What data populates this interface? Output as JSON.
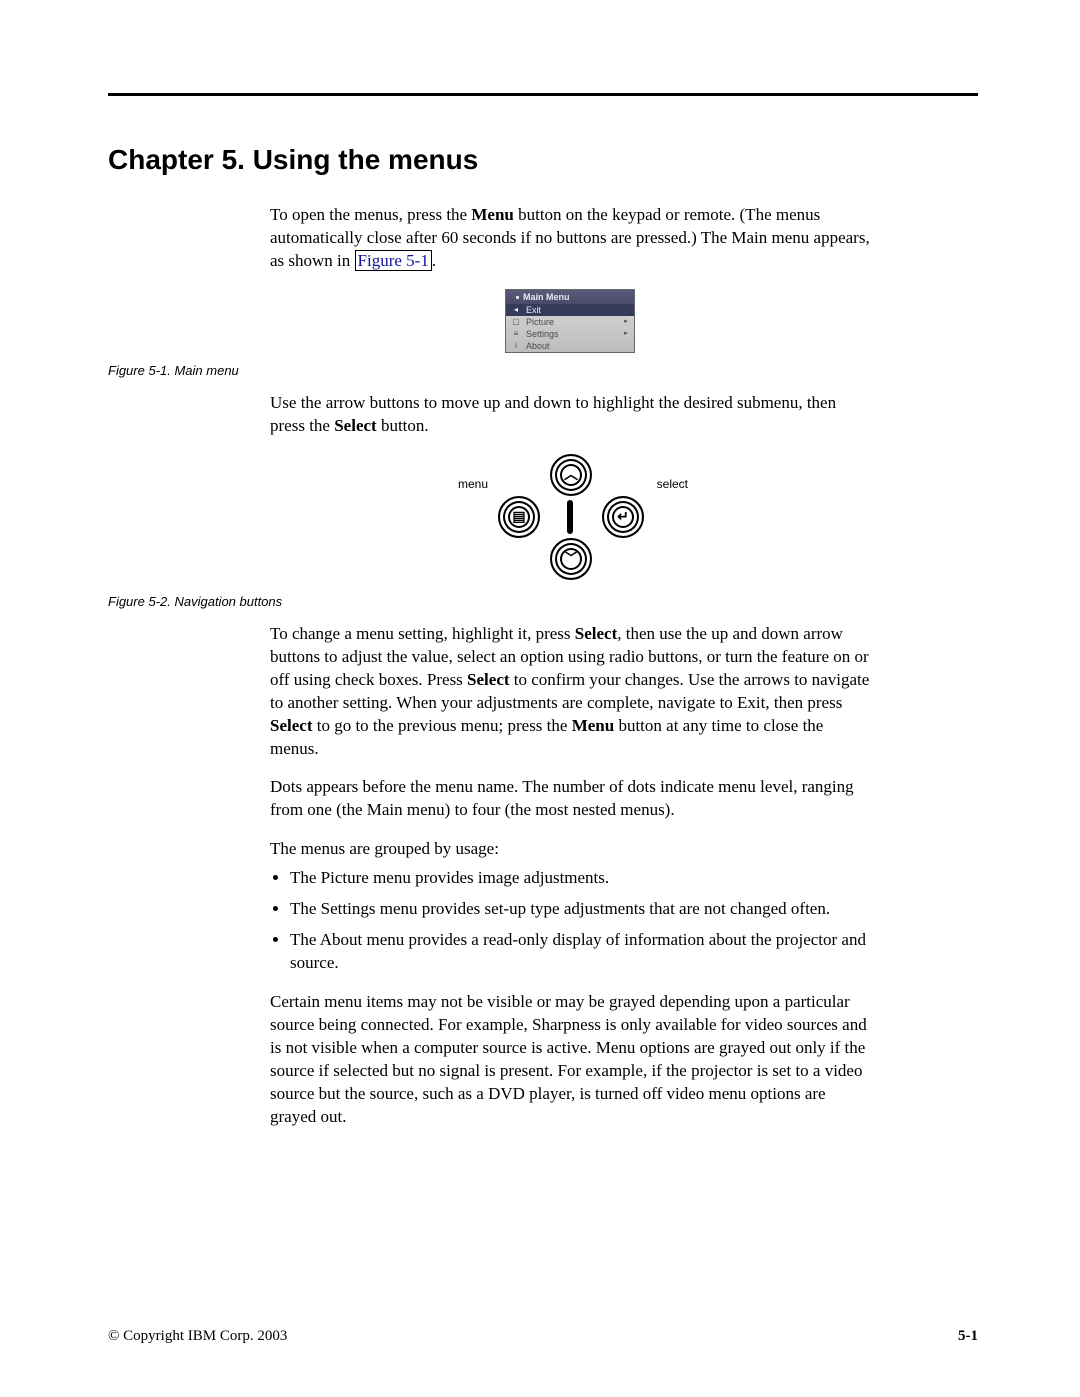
{
  "chapter_title": "Chapter 5. Using the menus",
  "para1": {
    "pre": "To open the menus, press the ",
    "b1": "Menu",
    "mid": " button on the keypad or remote. (The menus automatically close after 60 seconds if no buttons are pressed.) The Main menu appears, as shown in ",
    "link": "Figure 5-1",
    "post": "."
  },
  "fig1": {
    "title": "Main Menu",
    "items": [
      {
        "icon": "◂",
        "label": "Exit",
        "arrow": ""
      },
      {
        "icon": "▢",
        "label": "Picture",
        "arrow": "▸"
      },
      {
        "icon": "≡",
        "label": "Settings",
        "arrow": "▸"
      },
      {
        "icon": "i",
        "label": "About",
        "arrow": ""
      }
    ],
    "caption": "Figure 5-1. Main menu"
  },
  "para2": {
    "pre": "Use the arrow buttons to move up and down to highlight the desired submenu, then press the ",
    "b1": "Select",
    "post": " button."
  },
  "fig2": {
    "label_menu": "menu",
    "label_select": "select",
    "caption": "Figure 5-2. Navigation buttons"
  },
  "para3": {
    "t1": "To change a menu setting, highlight it, press ",
    "b1": "Select",
    "t2": ", then use the up and down arrow buttons to adjust the value, select an option using radio buttons, or turn the feature on or off using check boxes. Press ",
    "b2": "Select",
    "t3": " to confirm your changes. Use the arrows to navigate to another setting. When your adjustments are complete, navigate to Exit, then press ",
    "b3": "Select",
    "t4": " to go to the previous menu; press the ",
    "b4": "Menu",
    "t5": " button at any time to close the menus."
  },
  "para4": "Dots appears before the menu name. The number of dots indicate menu level, ranging from one (the Main menu) to four (the most nested menus).",
  "para5": "The menus are grouped by usage:",
  "bullets": [
    "The Picture menu provides image adjustments.",
    "The Settings menu provides set-up type adjustments that are not changed often.",
    "The About menu provides a read-only display of information about the projector and source."
  ],
  "para6": "Certain menu items may not be visible or may be grayed depending upon a particular source being connected. For example, Sharpness is only available for video sources and is not visible when a computer source is active. Menu options are grayed out only if the source if selected but no signal is present. For example, if the projector is set to a video source but the source, such as a DVD player, is turned off video menu options are grayed out.",
  "footer": {
    "copyright": "© Copyright IBM Corp. 2003",
    "page": "5-1"
  }
}
